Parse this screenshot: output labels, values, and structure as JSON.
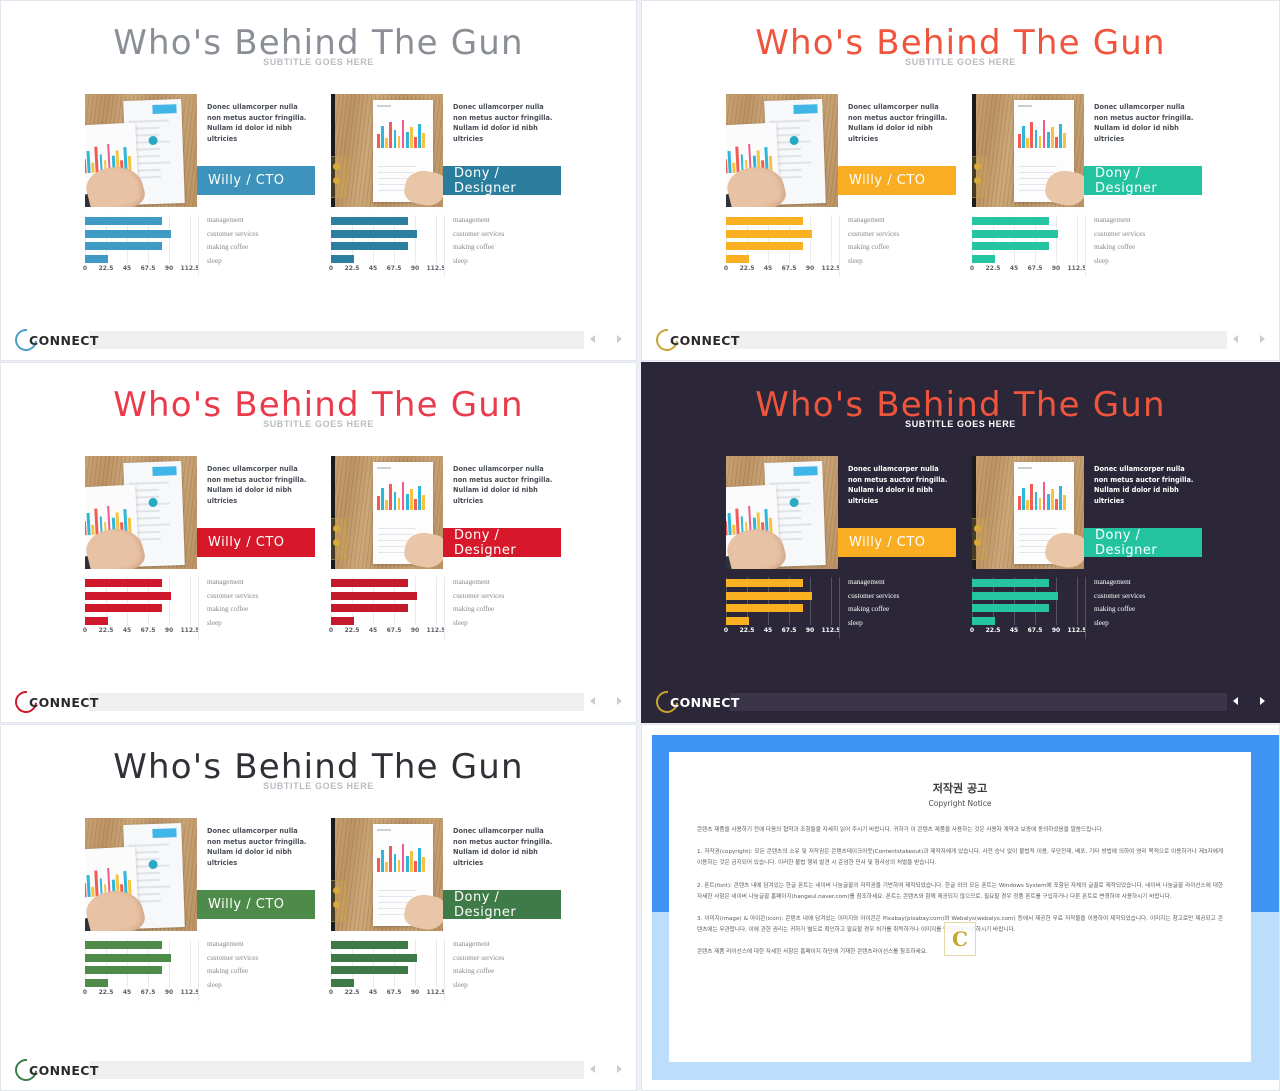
{
  "slide": {
    "title": "Who's Behind The Gun",
    "subtitle": "SUBTITLE GOES HERE",
    "body_text": "Donec ullamcorper nulla non metus auctor fringilla. Nullam id dolor id nibh ultricies",
    "people": [
      {
        "name": "Willy / CTO"
      },
      {
        "name": "Dony / Designer"
      }
    ]
  },
  "chart_data": {
    "type": "bar",
    "orientation": "horizontal",
    "title": "",
    "xlabel": "",
    "ylabel": "",
    "categories": [
      "management",
      "customer services",
      "making coffee",
      "sleep"
    ],
    "values": [
      82,
      92,
      82,
      25
    ],
    "xticks": [
      "0",
      "22.5",
      "45",
      "67.5",
      "90",
      "112.5"
    ],
    "xlim": [
      0,
      112.5
    ],
    "grid": true,
    "legend": "right"
  },
  "footer": {
    "logo_text": "CONNECT",
    "prev_label": "◀",
    "next_label": "▶"
  },
  "themes": [
    {
      "id": "blue",
      "title_color": "#8a8f96",
      "accent_left": "#3d93bb",
      "accent_right": "#2b7d9e",
      "bar_left": "#3f9bc4",
      "bar_right": "#2d7f9f",
      "logo_color": "#4a9ec4",
      "bg": "#ffffff"
    },
    {
      "id": "orange-teal",
      "title_color": "#ef553d",
      "accent_left": "#f8ad23",
      "accent_right": "#23c3a0",
      "bar_left": "#f9b122",
      "bar_right": "#25c5a2",
      "logo_color": "#c8a531",
      "bg": "#ffffff"
    },
    {
      "id": "red",
      "title_color": "#ea3b4c",
      "accent_left": "#d7182a",
      "accent_right": "#d7182a",
      "bar_left": "#d0182c",
      "bar_right": "#c31a2c",
      "logo_color": "#d0182c",
      "bg": "#ffffff"
    },
    {
      "id": "dark",
      "title_color": "#ef553d",
      "accent_left": "#f8ad23",
      "accent_right": "#23c3a0",
      "bar_left": "#f9b122",
      "bar_right": "#25c5a2",
      "logo_color": "#c8a531",
      "bg": "#2b2738"
    },
    {
      "id": "green",
      "title_color": "#2f3136",
      "accent_left": "#4e8b4a",
      "accent_right": "#3f7a49",
      "bar_left": "#4e8b4a",
      "bar_right": "#3e7a48",
      "logo_color": "#3c7a46",
      "bg": "#ffffff"
    }
  ],
  "copyright": {
    "title_ko": "저작권 공고",
    "title_en": "Copyright Notice",
    "watermark": "C",
    "paragraphs": [
      "콘텐츠 제품을 사용하기 전에 다음의 협약과 조항들을 자세히 읽어 주시기 바랍니다. 귀하가 이 콘텐츠 제품을 사용하는 것은 사용자 계약과 보증에 동의하셨음을 말씀드립니다.",
      "1. 저작권(copyright): 모든 콘텐츠의 소유 및 저작권은 콘텐츠테이크아웃(Contentstakeout)과 제작자에게 있습니다. 사전 승낙 없이 불법적 이용, 무단전재, 배포, 기타 방법에 의하여 영리 목적으로 이용하거나 제3자에게 이용하는 것은 금지되어 있습니다. 이러한 불법 행위 발견 시 준엄한 민사 및 형사상의 처벌을 받습니다.",
      "2. 폰트(font): 콘텐츠 내에 담겨있는 한글 폰트는 네이버 나눔글꼴의 저작권을 기반하여 제작되었습니다. 한글 외의 모든 폰트는 Windows System에 포함된 자체의 글꼴로 제작되었습니다. 네이버 나눔글꼴 라이선스에 대한 자세한 사항은 네이버 나눔글꼴 홈페이지(hangeul.naver.com)를 참조하세요. 폰트는 콘텐츠와 함께 제공되지 않으므로, 필요할 경우 정품 폰트를 구입하거나 다른 폰트로 변경하여 사용하시기 바랍니다.",
      "3. 이미지(image) & 아이콘(icon): 콘텐츠 내에 담겨있는 이미지와 아이콘은 Pixabay(pixabay.com)와 Webalys(webalys.com) 등에서 제공한 무료 저작물을 이용하여 제작되었습니다. 이미지는 참고로만 제공되고 콘텐츠에는 무관합니다. 이에 관한 권리는 귀하가 별도로 확인하고 필요할 경우 허가를 취득하거나 이미지를 변경하여 사용하시기 바랍니다.",
      "콘텐츠 제품 라이선스에 대한 자세한 사항은 홈페이지 하단에 기재한 콘텐츠라이선스를 참조하세요."
    ]
  }
}
